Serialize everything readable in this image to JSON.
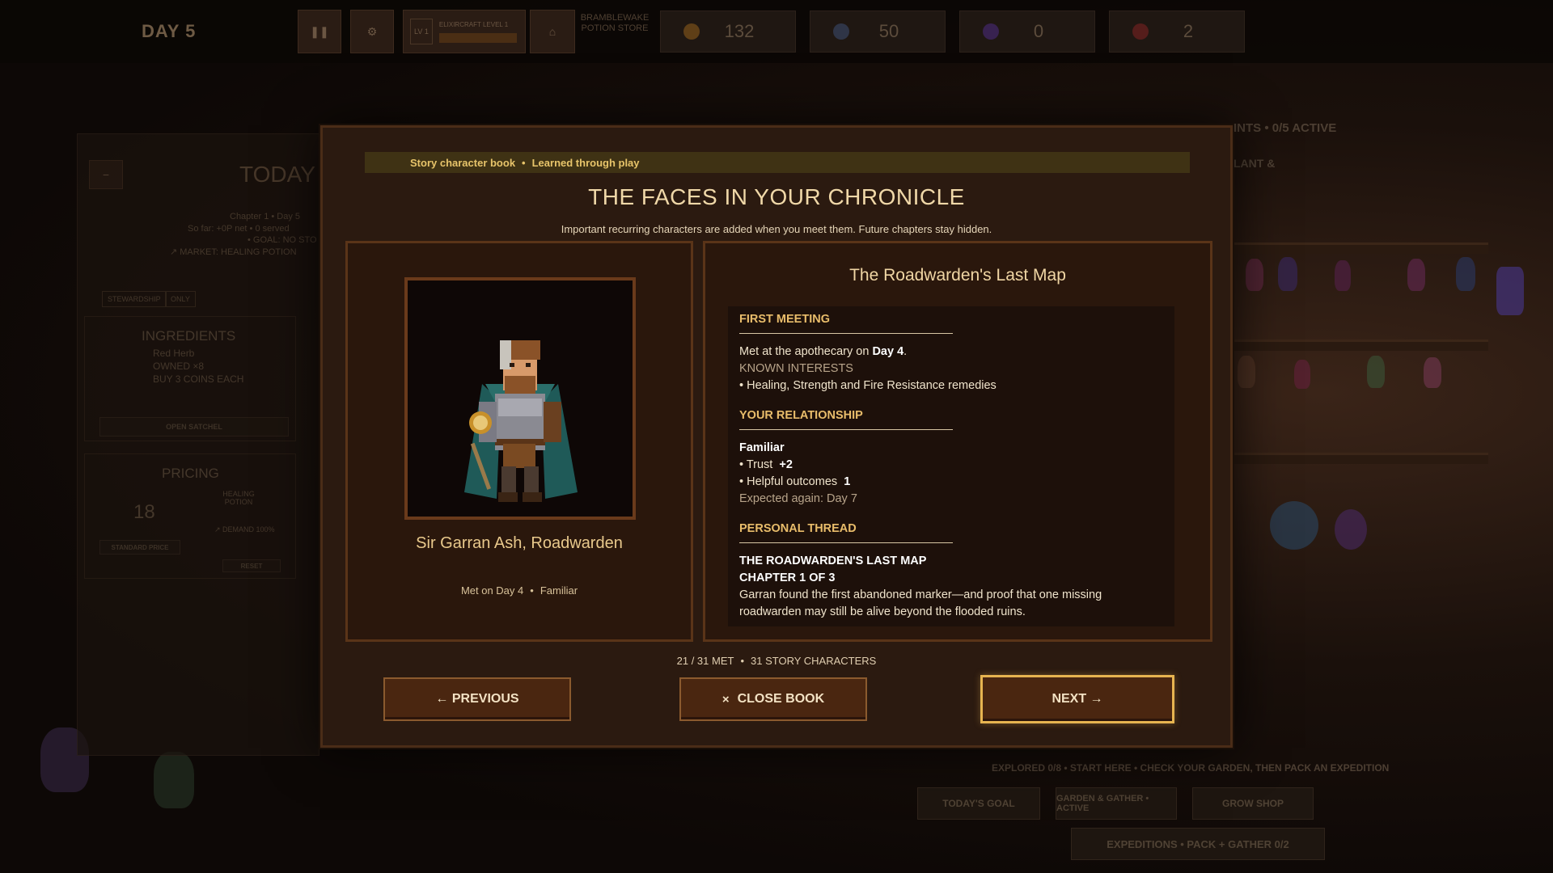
{
  "topbar": {
    "day": "DAY 5",
    "level_badge": "LV 1",
    "level_label": "ELIXIRCRAFT LEVEL 1",
    "store_name": "BRAMBLEWAKE POTION STORE",
    "resources": [
      {
        "icon": "coin-icon",
        "value": "132",
        "color": "#b07a2a"
      },
      {
        "icon": "gear-icon",
        "value": "50",
        "color": "#6a7aa0"
      },
      {
        "icon": "crystal-icon",
        "value": "0",
        "color": "#7a4ab0"
      },
      {
        "icon": "heart-icon",
        "value": "2",
        "color": "#b03a3a"
      }
    ]
  },
  "background": {
    "left_panel": {
      "today": "TODAY",
      "chapter": "Chapter 1 • Day 5",
      "so_far": "So far: +0P net • 0 served",
      "goal": "• GOAL: NO STO",
      "market": "↗ MARKET: HEALING POTION",
      "tabs": [
        "STEWARDSHIP",
        "ONLY"
      ],
      "ingredients_title": "INGREDIENTS",
      "ingredient_name": "Red Herb",
      "owned": "OWNED ×8",
      "buy": "BUY 3 COINS EACH",
      "open_satchel": "OPEN SATCHEL",
      "pricing_title": "PRICING",
      "price": "18",
      "potion": "HEALING POTION",
      "demand": "↗ DEMAND 100%",
      "standard_price": "STANDARD PRICE",
      "reset": "RESET"
    },
    "right_hint": "INTS • 0/5 ACTIVE",
    "right_hint2": "LANT &",
    "explored": "EXPLORED 0/8 • START HERE • CHECK YOUR GARDEN, THEN PACK AN EXPEDITION",
    "bottom_buttons": [
      "TODAY'S GOAL",
      "GARDEN & GATHER • ACTIVE",
      "GROW SHOP"
    ],
    "expeditions": "EXPEDITIONS • PACK + GATHER 0/2"
  },
  "modal": {
    "banner_left": "Story character book",
    "banner_sep": "•",
    "banner_right": "Learned through play",
    "title": "THE FACES IN YOUR CHRONICLE",
    "subtitle": "Important recurring characters are added when you meet them. Future chapters stay hidden.",
    "character": {
      "name": "Sir Garran Ash, Roadwarden",
      "met": "Met on Day 4",
      "sep": "•",
      "status": "Familiar",
      "portrait_icon": "knight-portrait-icon"
    },
    "story": {
      "title": "The Roadwarden's Last Map",
      "first_meeting_heading": "FIRST MEETING",
      "met_prefix": "Met at the apothecary on ",
      "met_day": "Day 4",
      "met_suffix": ".",
      "known_interests": "KNOWN INTERESTS",
      "interests": "• Healing, Strength and Fire Resistance remedies",
      "relationship_heading": "YOUR RELATIONSHIP",
      "relationship_level": "Familiar",
      "trust_label": "• Trust",
      "trust_value": "+2",
      "helpful_label": "• Helpful outcomes",
      "helpful_value": "1",
      "expected": "Expected again: Day 7",
      "thread_heading": "PERSONAL THREAD",
      "thread_title": "THE ROADWARDEN'S LAST MAP",
      "thread_chapter": "CHAPTER 1 OF 3",
      "thread_text": "Garran found the first abandoned marker—and proof that one missing roadwarden may still be alive beyond the flooded ruins."
    },
    "counter_met": "21 / 31 MET",
    "counter_sep": "•",
    "counter_total": "31 STORY CHARACTERS",
    "buttons": {
      "previous": "← PREVIOUS",
      "close_icon": "×",
      "close": "CLOSE BOOK",
      "next": "NEXT →"
    }
  }
}
